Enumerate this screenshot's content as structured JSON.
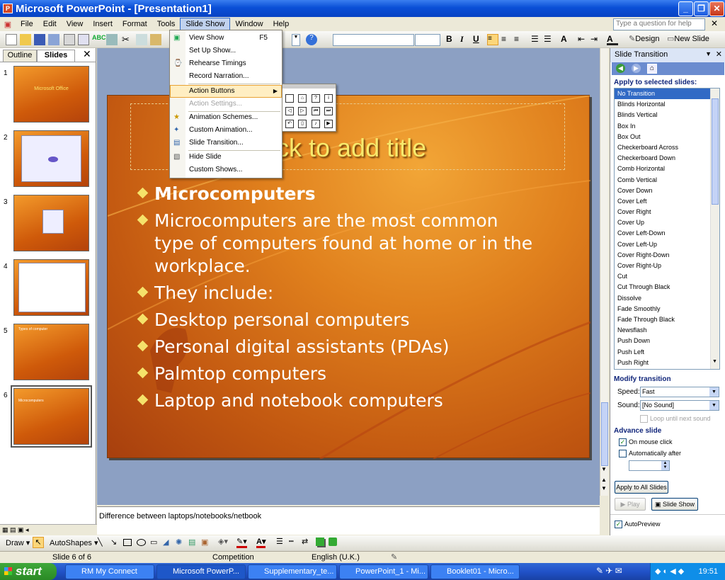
{
  "window": {
    "title": "Microsoft PowerPoint - [Presentation1]"
  },
  "menubar": {
    "items": [
      "File",
      "Edit",
      "View",
      "Insert",
      "Format",
      "Tools",
      "Slide Show",
      "Window",
      "Help"
    ],
    "help_placeholder": "Type a question for help"
  },
  "toolbar": {
    "design": "Design",
    "new_slide": "New Slide"
  },
  "leftpane": {
    "tabs": [
      "Outline",
      "Slides"
    ],
    "thumbs": [
      {
        "num": "1",
        "text": "Microsoft Office"
      },
      {
        "num": "2",
        "text": ""
      },
      {
        "num": "3",
        "text": ""
      },
      {
        "num": "4",
        "text": ""
      },
      {
        "num": "5",
        "text": "Types of computer"
      },
      {
        "num": "6",
        "text": "Microcomputers"
      }
    ]
  },
  "slide": {
    "title": "ck to add title",
    "bullets": [
      "Microcomputers",
      "Microcomputers are the most common",
      "type of computers found at home or in the",
      "workplace.",
      "They include:",
      "Desktop personal computers",
      "Personal digital assistants (PDAs)",
      "Palmtop computers",
      "Laptop and notebook computers"
    ]
  },
  "notes": {
    "text": "Difference between laptops/notebooks/netbook"
  },
  "slideshow_menu": {
    "items": [
      {
        "label": "View Show",
        "shortcut": "F5"
      },
      {
        "label": "Set Up Show..."
      },
      {
        "label": "Rehearse Timings"
      },
      {
        "label": "Record Narration..."
      },
      {
        "label": "Action Buttons"
      },
      {
        "label": "Action Settings..."
      },
      {
        "label": "Animation Schemes..."
      },
      {
        "label": "Custom Animation..."
      },
      {
        "label": "Slide Transition..."
      },
      {
        "label": "Hide Slide"
      },
      {
        "label": "Custom Shows..."
      }
    ]
  },
  "taskpane": {
    "title": "Slide Transition",
    "apply_heading": "Apply to selected slides:",
    "transitions": [
      "No Transition",
      "Blinds Horizontal",
      "Blinds Vertical",
      "Box In",
      "Box Out",
      "Checkerboard Across",
      "Checkerboard Down",
      "Comb Horizontal",
      "Comb Vertical",
      "Cover Down",
      "Cover Left",
      "Cover Right",
      "Cover Up",
      "Cover Left-Down",
      "Cover Left-Up",
      "Cover Right-Down",
      "Cover Right-Up",
      "Cut",
      "Cut Through Black",
      "Dissolve",
      "Fade Smoothly",
      "Fade Through Black",
      "Newsflash",
      "Push Down",
      "Push Left",
      "Push Right"
    ],
    "modify_heading": "Modify transition",
    "speed_label": "Speed:",
    "speed_value": "Fast",
    "sound_label": "Sound:",
    "sound_value": "[No Sound]",
    "loop_label": "Loop until next sound",
    "advance_heading": "Advance slide",
    "on_click_label": "On mouse click",
    "auto_label": "Automatically after",
    "apply_all": "Apply to All Slides",
    "play": "Play",
    "slide_show": "Slide Show",
    "autopreview": "AutoPreview"
  },
  "drawbar": {
    "draw": "Draw",
    "autoshapes": "AutoShapes"
  },
  "status": {
    "slide": "Slide 6 of 6",
    "design": "Competition",
    "lang": "English (U.K.)"
  },
  "taskbar": {
    "start": "start",
    "tasks": [
      "RM My Connect",
      "Microsoft PowerP...",
      "Supplementary_te...",
      "PowerPoint_1 - Mi...",
      "Booklet01 - Micro..."
    ],
    "clock": "19:51"
  }
}
